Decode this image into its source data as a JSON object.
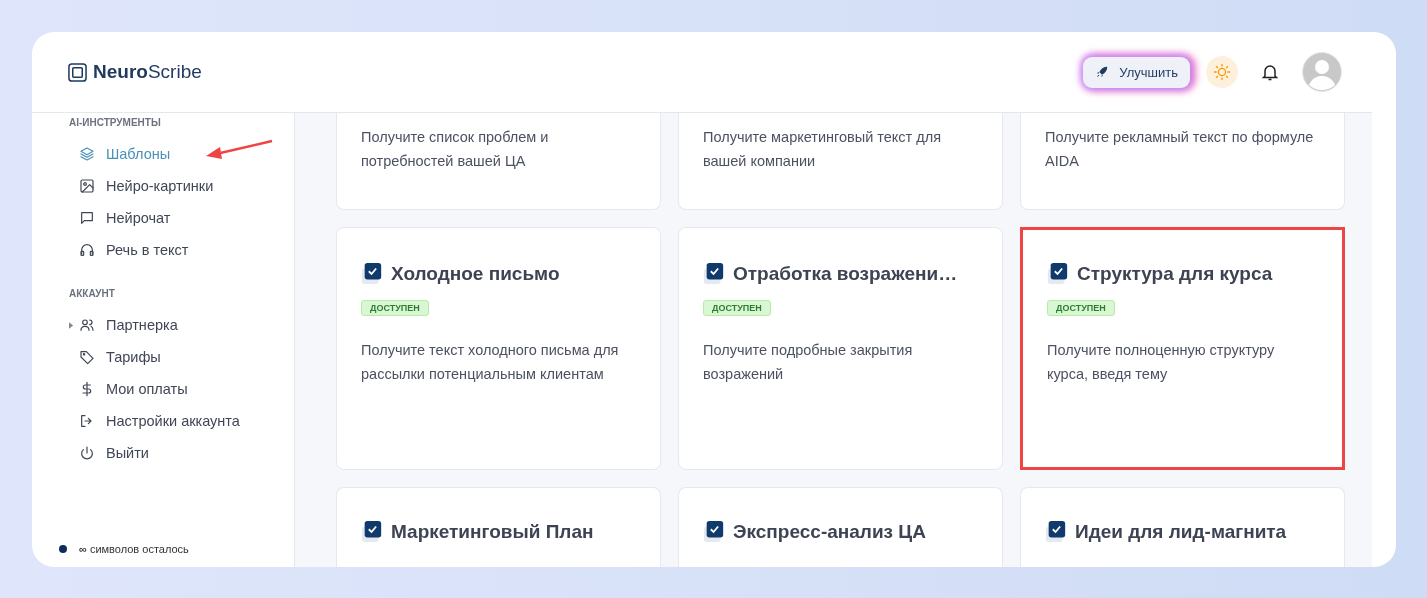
{
  "logo": {
    "bold": "Neuro",
    "light": "Scribe"
  },
  "header": {
    "upgrade_button": "Улучшить"
  },
  "sidebar": {
    "sections": [
      {
        "title": "AI-ИНСТРУМЕНТЫ",
        "items": [
          {
            "label": "Шаблоны",
            "selected": true,
            "kind": "link"
          },
          {
            "label": "Нейро-картинки",
            "selected": false,
            "kind": "link"
          },
          {
            "label": "Нейрочат",
            "selected": false,
            "kind": "link"
          },
          {
            "label": "Речь в текст",
            "selected": false,
            "kind": "link"
          }
        ]
      },
      {
        "title": "АККАУНТ",
        "items": [
          {
            "label": "Партнерка",
            "selected": false,
            "kind": "group"
          },
          {
            "label": "Тарифы",
            "selected": false,
            "kind": "link"
          },
          {
            "label": "Мои оплаты",
            "selected": false,
            "kind": "link"
          },
          {
            "label": "Настройки аккаунта",
            "selected": false,
            "kind": "link"
          },
          {
            "label": "Выйти",
            "selected": false,
            "kind": "link"
          }
        ]
      }
    ],
    "footer": {
      "symbol": "∞",
      "text": "символов осталось"
    }
  },
  "templates": [
    {
      "description": "Получите список проблем и потребностей вашей ЦА",
      "highlighted": false,
      "kind": "partial-top"
    },
    {
      "description": "Получите маркетинговый текст для вашей компании",
      "highlighted": false,
      "kind": "partial-top"
    },
    {
      "description": "Получите рекламный текст по формуле AIDA",
      "highlighted": false,
      "kind": "partial-top"
    },
    {
      "title": "Холодное письмо",
      "badge": "ДОСТУПЕН",
      "description": "Получите текст холодного письма для рассылки потенциальным клиентам",
      "highlighted": false,
      "kind": "full"
    },
    {
      "title": "Отработка возражени…",
      "badge": "ДОСТУПЕН",
      "description": "Получите подробные закрытия возражений",
      "highlighted": false,
      "kind": "full"
    },
    {
      "title": "Структура для курса",
      "badge": "ДОСТУПЕН",
      "description": "Получите полноценную структуру курса, введя тему",
      "highlighted": true,
      "kind": "full"
    },
    {
      "title": "Маркетинговый План",
      "highlighted": false,
      "kind": "partial-bottom"
    },
    {
      "title": "Экспресс-анализ ЦА",
      "highlighted": false,
      "kind": "partial-bottom"
    },
    {
      "title": "Идеи для лид-магнита",
      "highlighted": false,
      "kind": "partial-bottom"
    }
  ]
}
